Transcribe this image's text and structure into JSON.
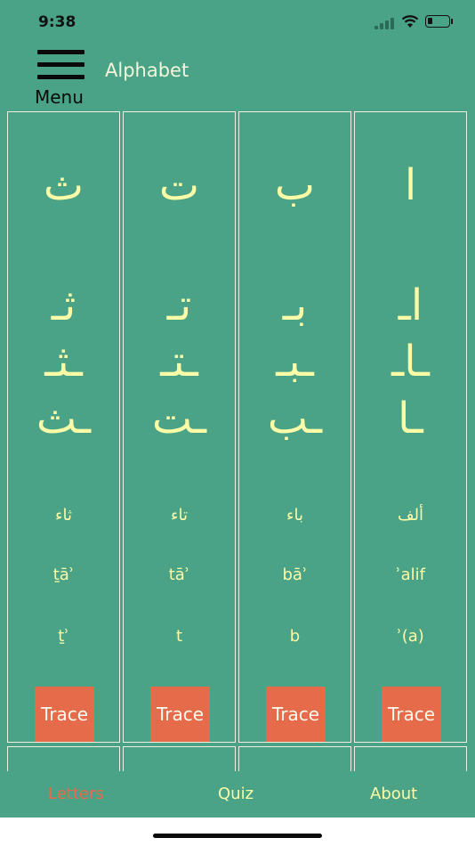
{
  "status_bar": {
    "time": "9:38"
  },
  "header": {
    "menu_label": "Menu",
    "title": "Alphabet"
  },
  "letters": [
    {
      "isolated": "ث",
      "initial": "ثـ",
      "medial": "ـثـ",
      "final": "ـث",
      "name_arabic": "ثاء",
      "transliteration": "ṯāʾ",
      "sound": "ṯʾ",
      "trace_label": "Trace"
    },
    {
      "isolated": "ت",
      "initial": "تـ",
      "medial": "ـتـ",
      "final": "ـت",
      "name_arabic": "تاء",
      "transliteration": "tāʾ",
      "sound": "t",
      "trace_label": "Trace"
    },
    {
      "isolated": "ب",
      "initial": "بـ",
      "medial": "ـبـ",
      "final": "ـب",
      "name_arabic": "باء",
      "transliteration": "bāʾ",
      "sound": "b",
      "trace_label": "Trace"
    },
    {
      "isolated": "ا",
      "initial": "اـ",
      "medial": "ـاـ",
      "final": "ـا",
      "name_arabic": "ألف",
      "transliteration": "ʾalif",
      "sound": "ʾ(a)",
      "trace_label": "Trace"
    }
  ],
  "tab_bar": {
    "tabs": [
      {
        "label": "Letters",
        "active": true
      },
      {
        "label": "Quiz",
        "active": false
      },
      {
        "label": "About",
        "active": false
      }
    ]
  },
  "colors": {
    "background": "#4aa386",
    "letter": "#fbfba8",
    "accent": "#e66b4a"
  }
}
